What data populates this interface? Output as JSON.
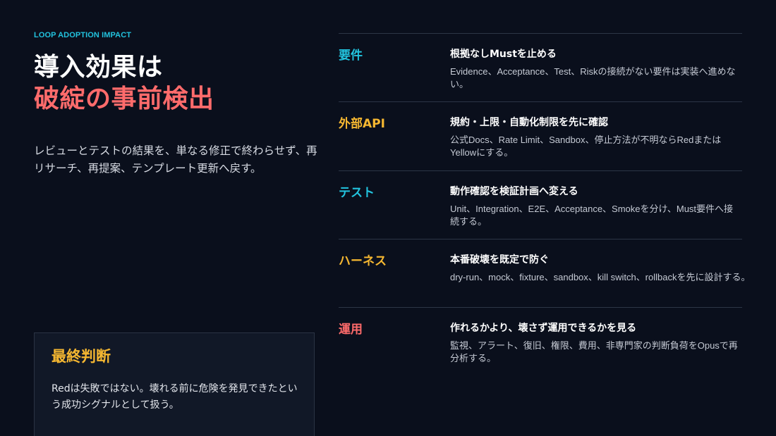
{
  "eyebrow": "LOOP ADOPTION IMPACT",
  "title_line1": "導入効果は",
  "title_line2": "破綻の事前検出",
  "lead": "レビューとテストの結果を、単なる修正で終わらせず、再リサーチ、再提案、テンプレート更新へ戻す。",
  "verdict": {
    "title": "最終判断",
    "body": "Redは失敗ではない。壊れる前に危険を発見できたという成功シグナルとして扱う。"
  },
  "rows": [
    {
      "label": "要件",
      "label_color": "#22c3de",
      "heading": "根拠なしMustを止める",
      "desc": "Evidence、Acceptance、Test、Riskの接続がない要件は実装へ進めない。"
    },
    {
      "label": "外部API",
      "label_color": "#f5b731",
      "heading": "規約・上限・自動化制限を先に確認",
      "desc": "公式Docs、Rate Limit、Sandbox、停止方法が不明ならRedまたはYellowにする。"
    },
    {
      "label": "テスト",
      "label_color": "#22c3de",
      "heading": "動作確認を検証計画へ変える",
      "desc": "Unit、Integration、E2E、Acceptance、Smokeを分け、Must要件へ接続する。"
    },
    {
      "label": "ハーネス",
      "label_color": "#f5b731",
      "heading": "本番破壊を既定で防ぐ",
      "desc": "dry-run、mock、fixture、sandbox、kill switch、rollbackを先に設計する。"
    },
    {
      "label": "運用",
      "label_color": "#ff6b6b",
      "heading": "作れるかより、壊さず運用できるかを見る",
      "desc": "監視、アラート、復旧、権限、費用、非専門家の判断負荷をOpusで再分析する。"
    }
  ]
}
